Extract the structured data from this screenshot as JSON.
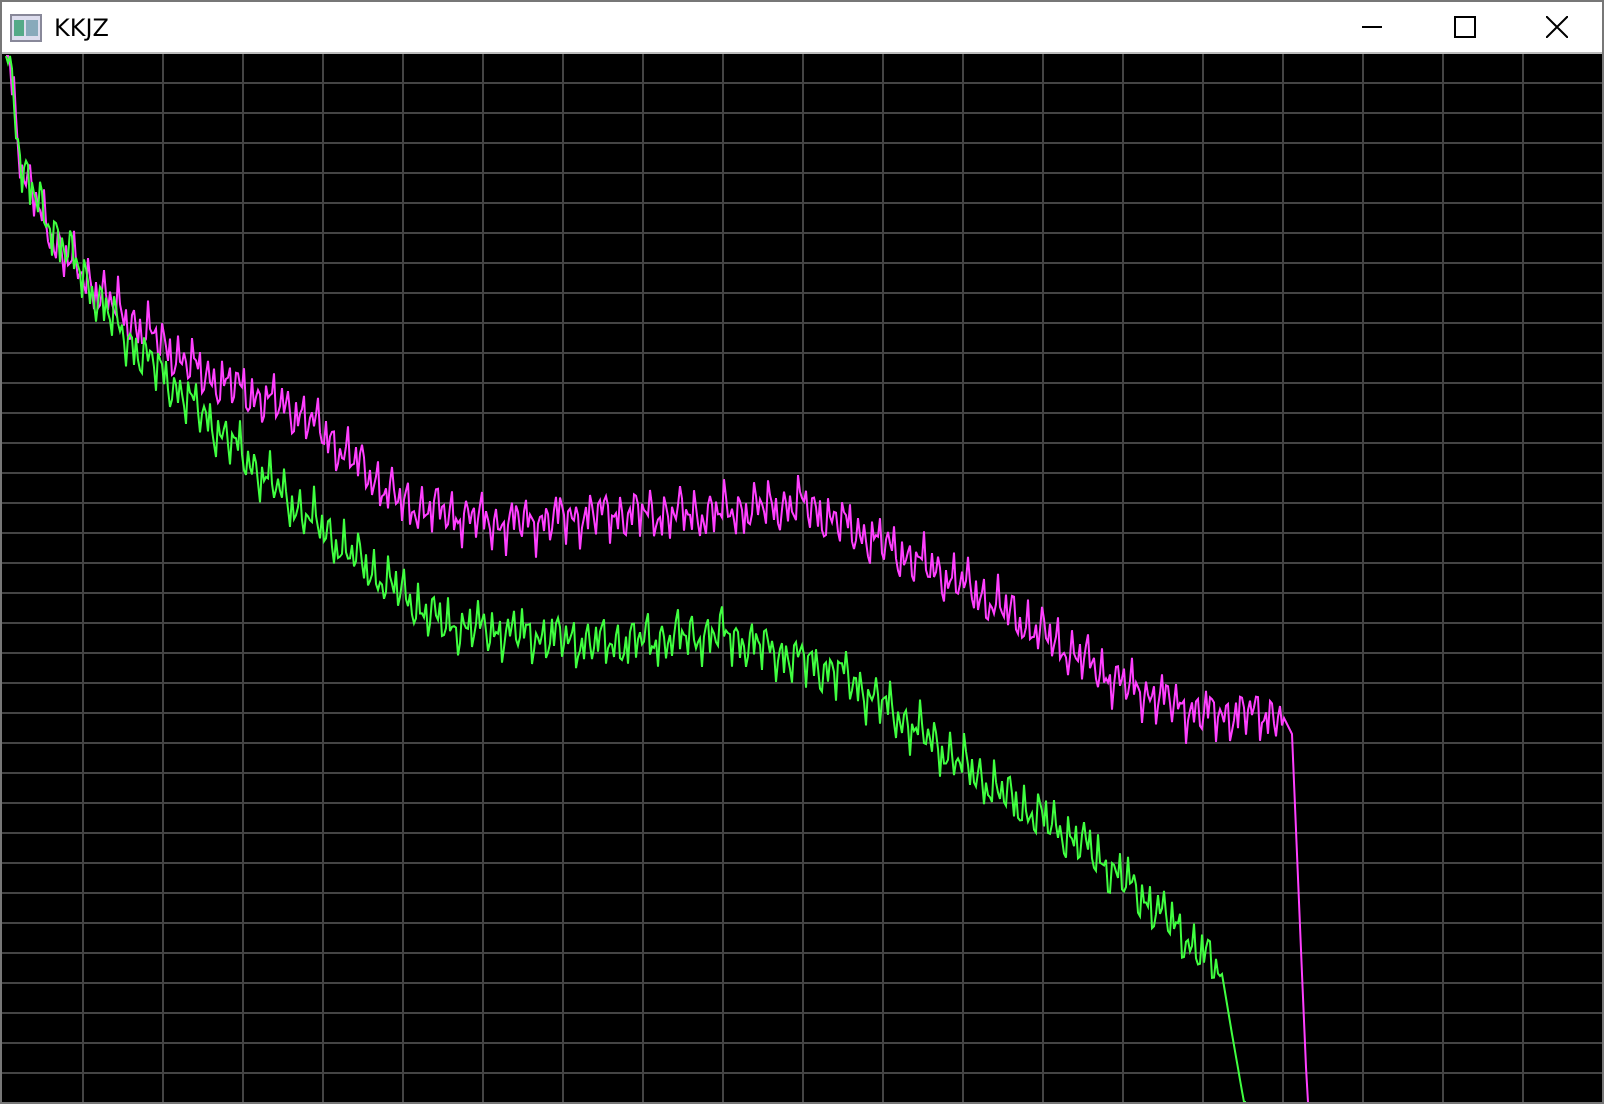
{
  "window": {
    "title": "KKJZ"
  },
  "plot": {
    "traces": [
      {
        "color": "#ff40ff"
      },
      {
        "color": "#40ff40"
      }
    ]
  }
}
